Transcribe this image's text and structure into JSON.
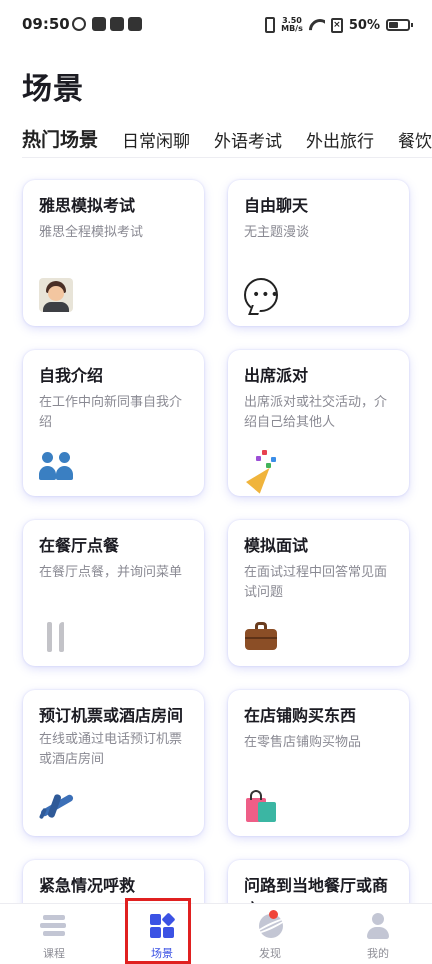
{
  "status_bar": {
    "time": "09:50",
    "speed_value": "3.50",
    "speed_unit": "MB/s",
    "battery": "50%"
  },
  "page": {
    "title": "场景"
  },
  "tabs": [
    {
      "label": "热门场景",
      "active": true
    },
    {
      "label": "日常闲聊",
      "active": false
    },
    {
      "label": "外语考试",
      "active": false
    },
    {
      "label": "外出旅行",
      "active": false
    },
    {
      "label": "餐饮",
      "active": false
    }
  ],
  "cards": [
    {
      "title": "雅思模拟考试",
      "desc": "雅思全程模拟考试",
      "icon": "teacher-icon"
    },
    {
      "title": "自由聊天",
      "desc": "无主题漫谈",
      "icon": "speech-bubble-icon"
    },
    {
      "title": "自我介绍",
      "desc": "在工作中向新同事自我介绍",
      "icon": "people-icon"
    },
    {
      "title": "出席派对",
      "desc": "出席派对或社交活动，介绍自己给其他人",
      "icon": "party-popper-icon"
    },
    {
      "title": "在餐厅点餐",
      "desc": "在餐厅点餐，并询问菜单",
      "icon": "fork-knife-icon"
    },
    {
      "title": "模拟面试",
      "desc": "在面试过程中回答常见面试问题",
      "icon": "briefcase-icon"
    },
    {
      "title": "预订机票或酒店房间",
      "desc": "在线或通过电话预订机票或酒店房间",
      "icon": "airplane-icon"
    },
    {
      "title": "在店铺购买东西",
      "desc": "在零售店铺购买物品",
      "icon": "shopping-bags-icon"
    },
    {
      "title": "紧急情况呼救",
      "desc": "",
      "icon": ""
    },
    {
      "title": "问路到当地餐厅或商店",
      "desc": "",
      "icon": ""
    }
  ],
  "bottom_nav": [
    {
      "label": "课程",
      "icon": "course-icon",
      "active": false
    },
    {
      "label": "场景",
      "icon": "scene-icon",
      "active": true
    },
    {
      "label": "发现",
      "icon": "discover-icon",
      "active": false,
      "badge": true
    },
    {
      "label": "我的",
      "icon": "profile-icon",
      "active": false
    }
  ],
  "colors": {
    "accent": "#3b52e4",
    "card_shadow": "#6b6eeb",
    "highlight": "#e02020",
    "badge": "#f0453a"
  }
}
